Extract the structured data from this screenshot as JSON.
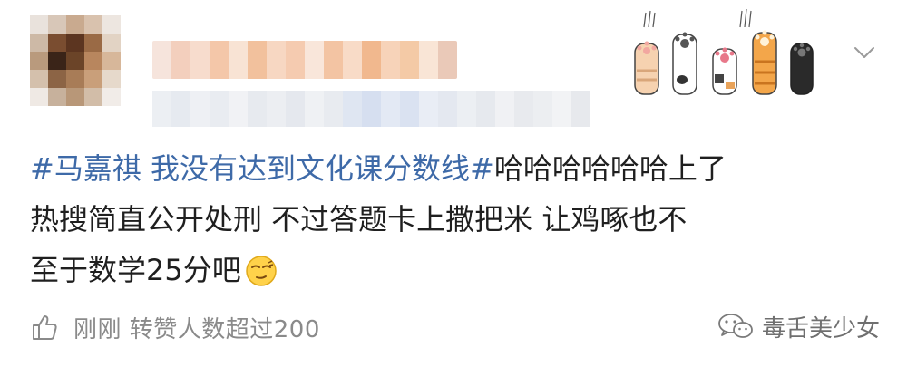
{
  "post": {
    "topic": "#马嘉祺 我没有达到文化课分数线#",
    "body_line1": "哈哈哈哈哈哈上了",
    "body_line2": "热搜简直公开处刑  不过答题卡上撒把米 让鸡啄也不",
    "body_line3": "至于数学25分吧",
    "emoji": "smirk-emoji"
  },
  "footer": {
    "like_icon": "thumbs-up-icon",
    "text": "刚刚 转赞人数超过200"
  },
  "watermark": {
    "icon": "wechat-icon",
    "text": "毒舌美少女"
  },
  "decor": {
    "paws": [
      "cat-paw-tabby-icon",
      "cat-paw-white-icon",
      "cat-paw-calico-icon",
      "cat-paw-orange-icon",
      "cat-paw-black-icon"
    ],
    "more_icon": "chevron-down-icon"
  },
  "colors": {
    "topic_link": "#3e6aa8",
    "meta_gray": "#8a8a8a"
  }
}
